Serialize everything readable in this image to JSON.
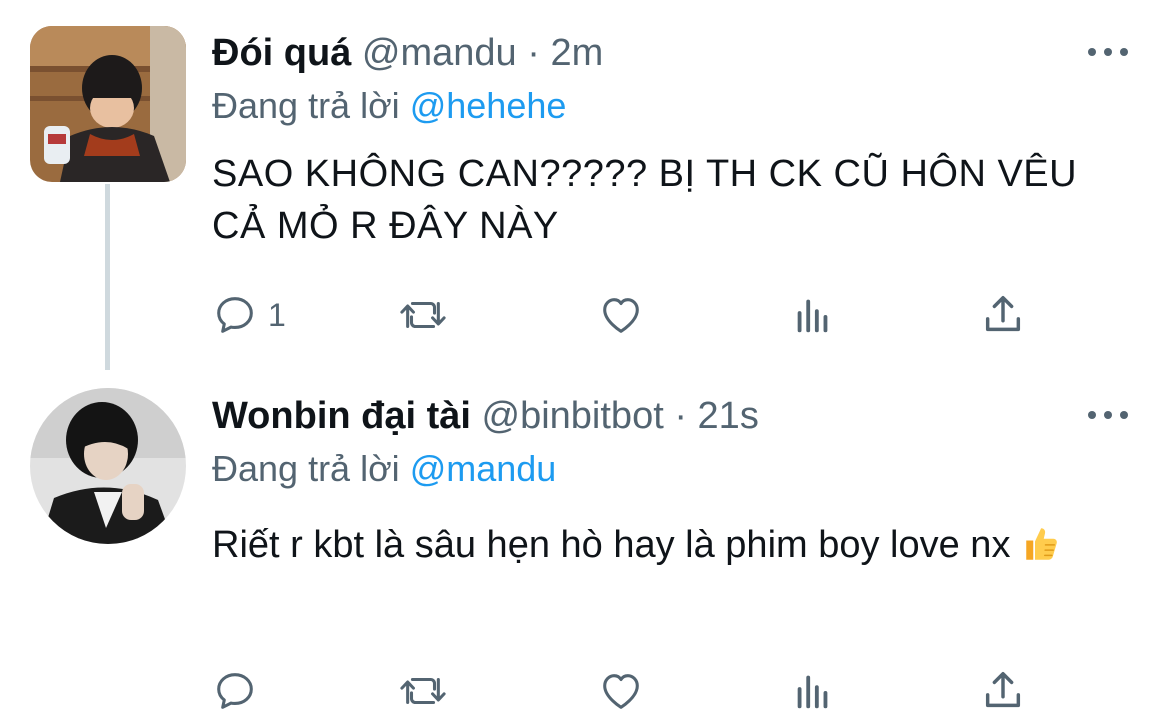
{
  "tweets": [
    {
      "display_name": "Đói quá",
      "handle": "@mandu",
      "separator": "·",
      "time": "2m",
      "replying_prefix": "Đang trả lời",
      "replying_to": "@hehehe",
      "text": "SAO KHÔNG CAN????? BỊ TH CK CŨ HÔN VÊU CẢ MỎ R ĐÂY NÀY",
      "reply_count": "1",
      "icons": {
        "reply": "reply-bubble-icon",
        "retweet": "retweet-icon",
        "like": "heart-icon",
        "views": "analytics-icon",
        "share": "share-icon",
        "more": "more-options-icon"
      }
    },
    {
      "display_name": "Wonbin đại tài",
      "handle": "@binbitbot",
      "separator": "·",
      "time": "21s",
      "replying_prefix": "Đang trả lời",
      "replying_to": "@mandu",
      "text": "Riết r kbt là sâu hẹn hò hay là phim boy love nx",
      "emoji": "thumbs-up",
      "reply_count": ""
    }
  ],
  "colors": {
    "text_primary": "#0f1419",
    "text_secondary": "#536471",
    "link": "#1d9bf0",
    "thread_line": "#cfd9de"
  }
}
